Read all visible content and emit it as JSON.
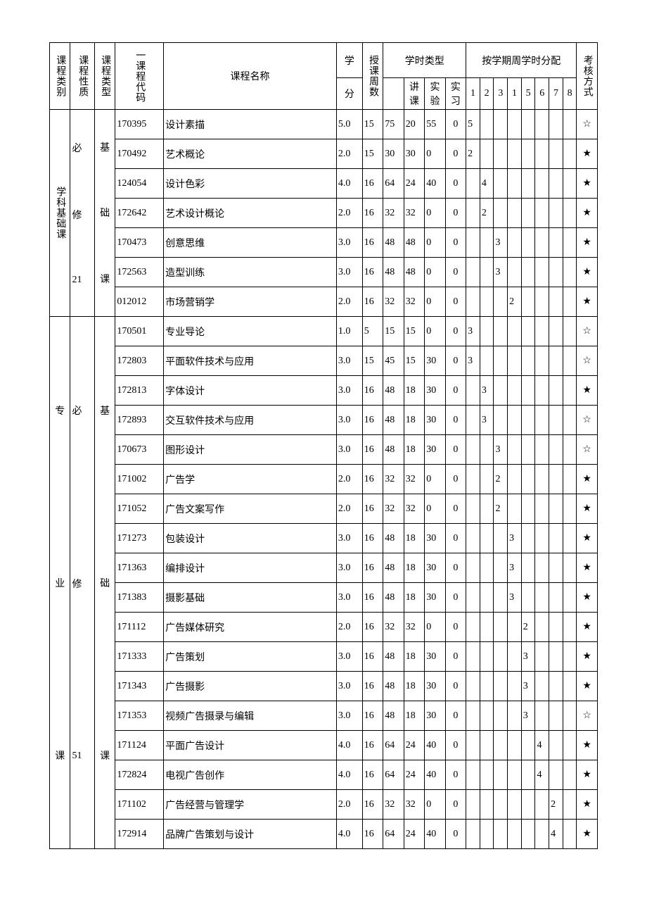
{
  "headers": {
    "category": "课程类别",
    "nature": "课程性质",
    "type": "课程类型",
    "code": "一课程代码",
    "name": "课程名称",
    "credit_top": "学",
    "credit_bottom": "分",
    "weeks": "授课周数",
    "hours_type": "学时类型",
    "lecture": "讲课",
    "lab": "实验",
    "practice": "实习",
    "semester_dist": "按学期周学时分配",
    "s1": "1",
    "s2": "2",
    "s3": "3",
    "s4": "1",
    "s5": "5",
    "s6": "6",
    "s7": "7",
    "s8": "8",
    "exam": "考核方式"
  },
  "group1": {
    "category": "学科基础课",
    "nature_top": "必",
    "nature_mid": "修",
    "nature_num": "21",
    "type_top": "基",
    "type_mid": "础",
    "type_bot": "课",
    "rows": [
      {
        "code": "170395",
        "name": "设计素描",
        "credit": "5.0",
        "weeks": "15",
        "total": "75",
        "lec": "20",
        "lab": "55",
        "prac": "0",
        "s": [
          "5",
          "",
          "",
          "",
          "",
          "",
          "",
          ""
        ],
        "exam": "☆"
      },
      {
        "code": "170492",
        "name": "艺术概论",
        "credit": "2.0",
        "weeks": "15",
        "total": "30",
        "lec": "30",
        "lab": "0",
        "prac": "0",
        "s": [
          "2",
          "",
          "",
          "",
          "",
          "",
          "",
          ""
        ],
        "exam": "★"
      },
      {
        "code": "124054",
        "name": "设计色彩",
        "credit": "4.0",
        "weeks": "16",
        "total": "64",
        "lec": "24",
        "lab": "40",
        "prac": "0",
        "s": [
          "",
          "4",
          "",
          "",
          "",
          "",
          "",
          ""
        ],
        "exam": "★"
      },
      {
        "code": "172642",
        "name": "艺术设计概论",
        "credit": "2.0",
        "weeks": "16",
        "total": "32",
        "lec": "32",
        "lab": "0",
        "prac": "0",
        "s": [
          "",
          "2",
          "",
          "",
          "",
          "",
          "",
          ""
        ],
        "exam": "★"
      },
      {
        "code": "170473",
        "name": "创意思维",
        "credit": "3.0",
        "weeks": "16",
        "total": "48",
        "lec": "48",
        "lab": "0",
        "prac": "0",
        "s": [
          "",
          "",
          "3",
          "",
          "",
          "",
          "",
          ""
        ],
        "exam": "★"
      },
      {
        "code": "172563",
        "name": "造型训练",
        "credit": "3.0",
        "weeks": "16",
        "total": "48",
        "lec": "48",
        "lab": "0",
        "prac": "0",
        "s": [
          "",
          "",
          "3",
          "",
          "",
          "",
          "",
          ""
        ],
        "exam": "★"
      },
      {
        "code": "012012",
        "name": "市场营销学",
        "credit": "2.0",
        "weeks": "16",
        "total": "32",
        "lec": "32",
        "lab": "0",
        "prac": "0",
        "s": [
          "",
          "",
          "",
          "2",
          "",
          "",
          "",
          ""
        ],
        "exam": "★"
      }
    ]
  },
  "group2": {
    "category_top": "专",
    "category_mid": "业",
    "category_bot": "课",
    "nature_top": "必",
    "nature_mid": "修",
    "nature_num": "51",
    "type_top": "基",
    "type_mid": "础",
    "type_bot": "课",
    "rows": [
      {
        "code": "170501",
        "name": "专业导论",
        "credit": "1.0",
        "weeks": "5",
        "total": "15",
        "lec": "15",
        "lab": "0",
        "prac": "0",
        "s": [
          "3",
          "",
          "",
          "",
          "",
          "",
          "",
          ""
        ],
        "exam": "☆"
      },
      {
        "code": "172803",
        "name": "平面软件技术与应用",
        "credit": "3.0",
        "weeks": "15",
        "total": "45",
        "lec": "15",
        "lab": "30",
        "prac": "0",
        "s": [
          "3",
          "",
          "",
          "",
          "",
          "",
          "",
          ""
        ],
        "exam": "☆"
      },
      {
        "code": "172813",
        "name": "字体设计",
        "credit": "3.0",
        "weeks": "16",
        "total": "48",
        "lec": "18",
        "lab": "30",
        "prac": "0",
        "s": [
          "",
          "3",
          "",
          "",
          "",
          "",
          "",
          ""
        ],
        "exam": "★"
      },
      {
        "code": "172893",
        "name": "交互软件技术与应用",
        "credit": "3.0",
        "weeks": "16",
        "total": "48",
        "lec": "18",
        "lab": "30",
        "prac": "0",
        "s": [
          "",
          "3",
          "",
          "",
          "",
          "",
          "",
          ""
        ],
        "exam": "☆"
      },
      {
        "code": "170673",
        "name": "图形设计",
        "credit": "3.0",
        "weeks": "16",
        "total": "48",
        "lec": "18",
        "lab": "30",
        "prac": "0",
        "s": [
          "",
          "",
          "3",
          "",
          "",
          "",
          "",
          ""
        ],
        "exam": "☆"
      },
      {
        "code": "171002",
        "name": "广告学",
        "credit": "2.0",
        "weeks": "16",
        "total": "32",
        "lec": "32",
        "lab": "0",
        "prac": "0",
        "s": [
          "",
          "",
          "2",
          "",
          "",
          "",
          "",
          ""
        ],
        "exam": "★"
      },
      {
        "code": "171052",
        "name": "广告文案写作",
        "credit": "2.0",
        "weeks": "16",
        "total": "32",
        "lec": "32",
        "lab": "0",
        "prac": "0",
        "s": [
          "",
          "",
          "2",
          "",
          "",
          "",
          "",
          ""
        ],
        "exam": "★"
      },
      {
        "code": "171273",
        "name": "包装设计",
        "credit": "3.0",
        "weeks": "16",
        "total": "48",
        "lec": "18",
        "lab": "30",
        "prac": "0",
        "s": [
          "",
          "",
          "",
          "3",
          "",
          "",
          "",
          ""
        ],
        "exam": "★"
      },
      {
        "code": "171363",
        "name": "编排设计",
        "credit": "3.0",
        "weeks": "16",
        "total": "48",
        "lec": "18",
        "lab": "30",
        "prac": "0",
        "s": [
          "",
          "",
          "",
          "3",
          "",
          "",
          "",
          ""
        ],
        "exam": "★"
      },
      {
        "code": "171383",
        "name": "摄影基础",
        "credit": "3.0",
        "weeks": "16",
        "total": "48",
        "lec": "18",
        "lab": "30",
        "prac": "0",
        "s": [
          "",
          "",
          "",
          "3",
          "",
          "",
          "",
          ""
        ],
        "exam": "★"
      },
      {
        "code": "171112",
        "name": "广告媒体研究",
        "credit": "2.0",
        "weeks": "16",
        "total": "32",
        "lec": "32",
        "lab": "0",
        "prac": "0",
        "s": [
          "",
          "",
          "",
          "",
          "2",
          "",
          "",
          ""
        ],
        "exam": "★"
      },
      {
        "code": "171333",
        "name": "广告策划",
        "credit": "3.0",
        "weeks": "16",
        "total": "48",
        "lec": "18",
        "lab": "30",
        "prac": "0",
        "s": [
          "",
          "",
          "",
          "",
          "3",
          "",
          "",
          ""
        ],
        "exam": "★"
      },
      {
        "code": "171343",
        "name": "广告摄影",
        "credit": "3.0",
        "weeks": "16",
        "total": "48",
        "lec": "18",
        "lab": "30",
        "prac": "0",
        "s": [
          "",
          "",
          "",
          "",
          "3",
          "",
          "",
          ""
        ],
        "exam": "★"
      },
      {
        "code": "171353",
        "name": "视频广告摄录与编辑",
        "credit": "3.0",
        "weeks": "16",
        "total": "48",
        "lec": "18",
        "lab": "30",
        "prac": "0",
        "s": [
          "",
          "",
          "",
          "",
          "3",
          "",
          "",
          ""
        ],
        "exam": "☆"
      },
      {
        "code": "171124",
        "name": "平面广告设计",
        "credit": "4.0",
        "weeks": "16",
        "total": "64",
        "lec": "24",
        "lab": "40",
        "prac": "0",
        "s": [
          "",
          "",
          "",
          "",
          "",
          "4",
          "",
          ""
        ],
        "exam": "★"
      },
      {
        "code": "172824",
        "name": "电视广告创作",
        "credit": "4.0",
        "weeks": "16",
        "total": "64",
        "lec": "24",
        "lab": "40",
        "prac": "0",
        "s": [
          "",
          "",
          "",
          "",
          "",
          "4",
          "",
          ""
        ],
        "exam": "★"
      },
      {
        "code": "171102",
        "name": "广告经营与管理学",
        "credit": "2.0",
        "weeks": "16",
        "total": "32",
        "lec": "32",
        "lab": "0",
        "prac": "0",
        "s": [
          "",
          "",
          "",
          "",
          "",
          "",
          "2",
          ""
        ],
        "exam": "★"
      },
      {
        "code": "172914",
        "name": "品牌广告策划与设计",
        "credit": "4.0",
        "weeks": "16",
        "total": "64",
        "lec": "24",
        "lab": "40",
        "prac": "0",
        "s": [
          "",
          "",
          "",
          "",
          "",
          "",
          "4",
          ""
        ],
        "exam": "★"
      }
    ]
  }
}
